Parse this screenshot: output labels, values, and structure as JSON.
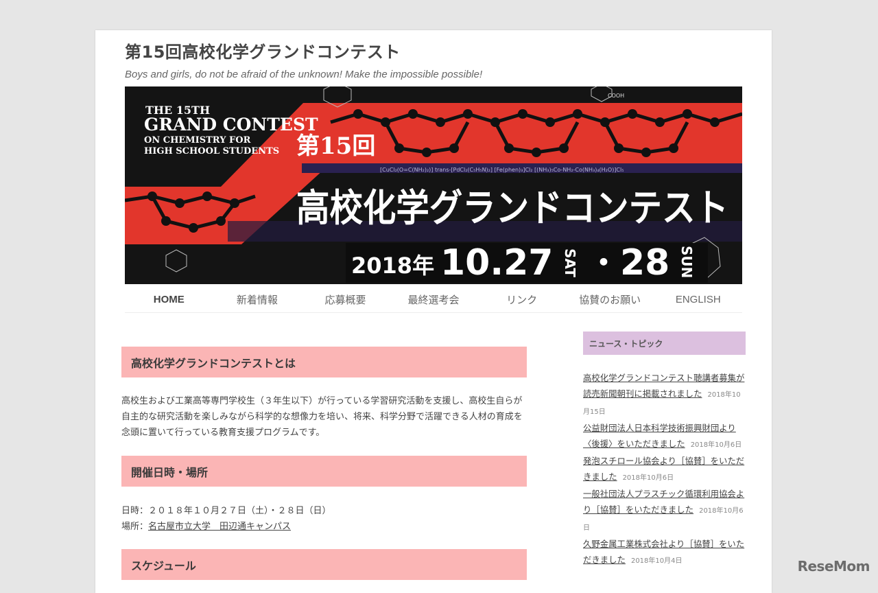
{
  "site": {
    "title": "第15回高校化学グランドコンテスト",
    "description": "Boys and girls, do not be afraid of the unknown! Make the impossible possible!"
  },
  "banner": {
    "en_line1": "THE 15TH",
    "en_line2": "GRAND CONTEST",
    "en_line3": "ON CHEMISTRY FOR",
    "en_line4": "HIGH SCHOOL STUDENTS",
    "jp_edition": "第15回",
    "jp_title": "高校化学グランドコンテスト",
    "year": "2018年",
    "date1": "10.27",
    "day1": "SAT",
    "dot": "・",
    "date2": "28",
    "day2": "SUN",
    "formula_top": "COOH",
    "formula_line": "[CuCl₂(O=C(NH₂)₂)] trans-[PdCl₂(C₅H₅N)₂] [Fe(phen)₃]Cl₂ [(NH₃)₅Co-NH₂-Co(NH₃)₄(H₂O)]Cl₅"
  },
  "nav": {
    "items": [
      "HOME",
      "新着情報",
      "応募概要",
      "最終選考会",
      "リンク",
      "協賛のお願い",
      "ENGLISH"
    ]
  },
  "main": {
    "about_heading": "高校化学グランドコンテストとは",
    "about_text": "高校生および工業高等専門学校生（３年生以下）が行っている学習研究活動を支援し、高校生自らが自主的な研究活動を楽しみながら科学的な想像力を培い、将来、科学分野で活躍できる人材の育成を念頭に置いて行っている教育支援プログラムです。",
    "venue_heading": "開催日時・場所",
    "date_line": "日時：２０１８年１０月２７日（土）・２８日（日）",
    "place_label": "場所：",
    "place_link": "名古屋市立大学　田辺通キャンパス",
    "schedule_heading": "スケジュール"
  },
  "sidebar": {
    "heading": "ニュース・トピック",
    "news": [
      {
        "title": "高校化学グランドコンテスト聴講者募集が読売新聞朝刊に掲載されました",
        "date": "2018年10月15日"
      },
      {
        "title": "公益財団法人日本科学技術振興財団より〈後援〉をいただきました",
        "date": "2018年10月6日"
      },
      {
        "title": "発泡スチロール協会より［協賛］をいただきました",
        "date": "2018年10月6日"
      },
      {
        "title": "一般社団法人プラスチック循環利用協会より［協賛］をいただきました",
        "date": "2018年10月6日"
      },
      {
        "title": "久野金属工業株式会社より［協賛］をいただきました",
        "date": "2018年10月4日"
      }
    ]
  },
  "watermark": "ReseMom",
  "colors": {
    "banner_red": "#e2362c",
    "section_pink": "#fbb5b5",
    "sidebar_purple": "#dcc0df"
  }
}
